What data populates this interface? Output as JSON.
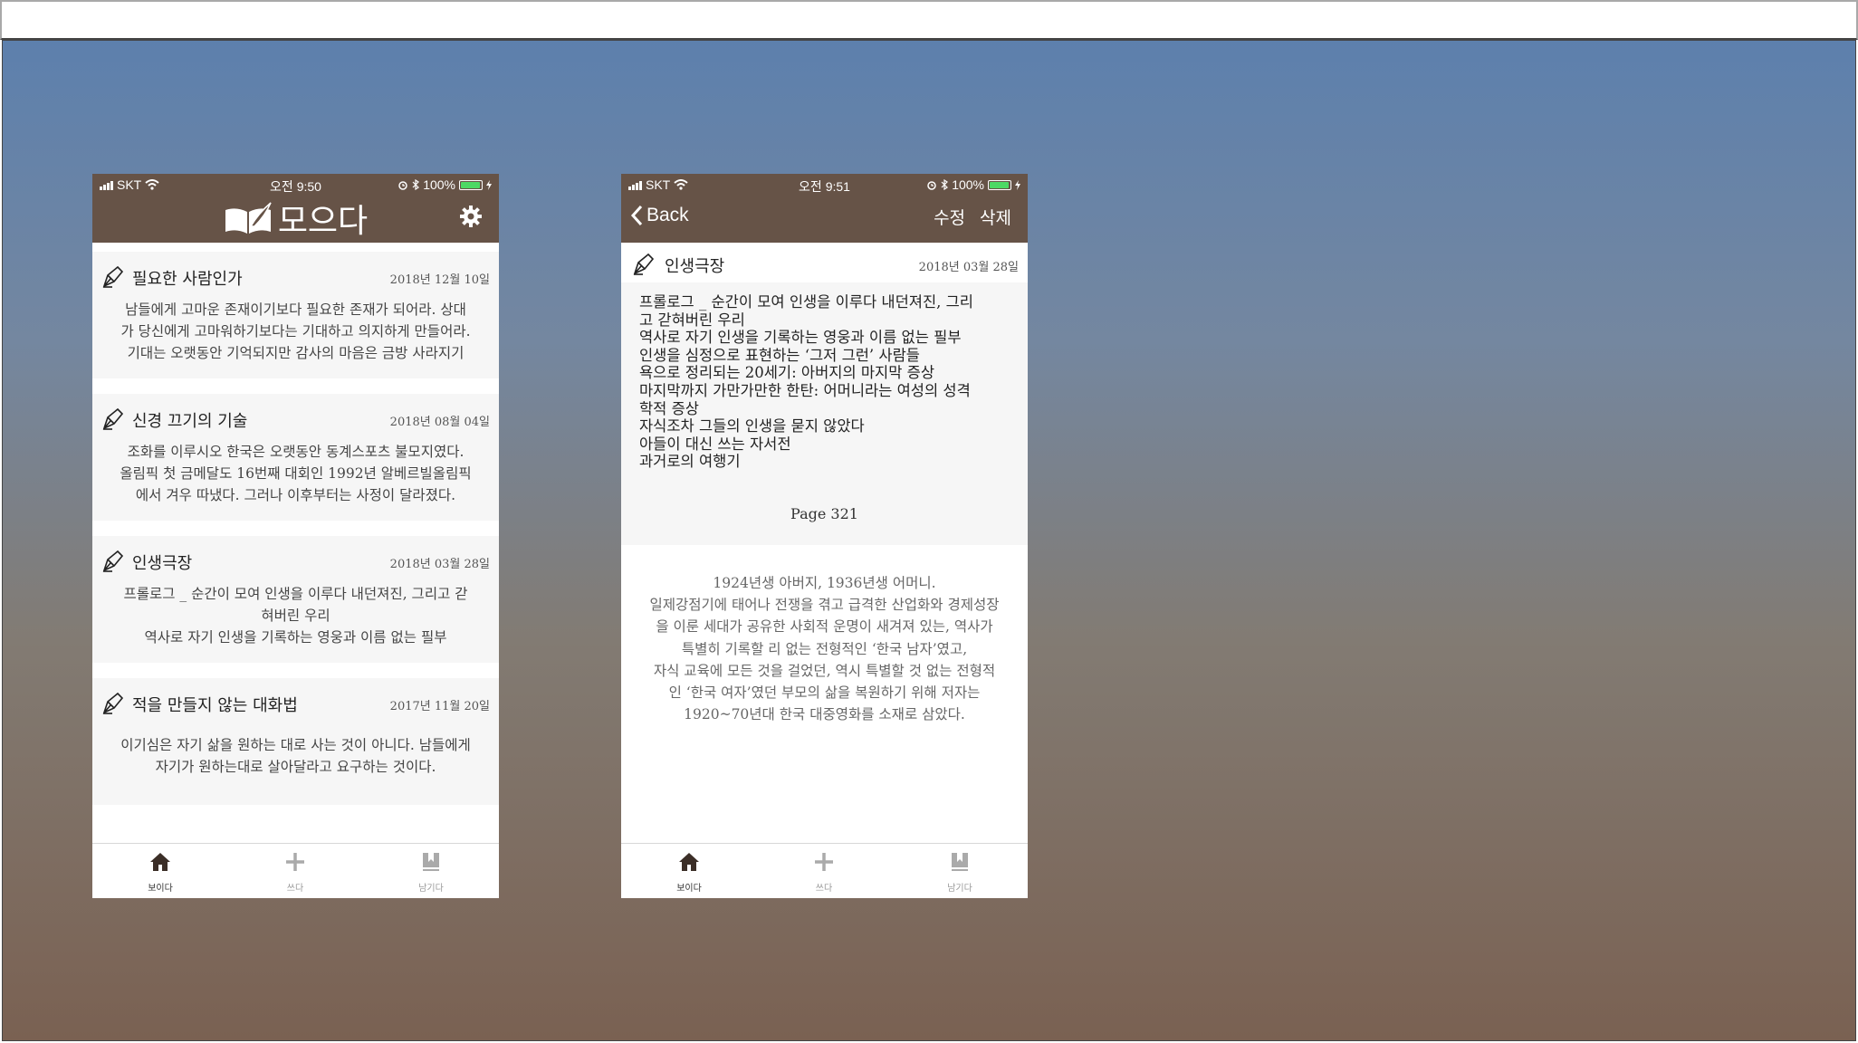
{
  "status_left": {
    "carrier": "SKT",
    "time": "오전 9:50",
    "battery": "100%"
  },
  "status_right": {
    "carrier": "SKT",
    "time": "오전 9:51",
    "battery": "100%"
  },
  "app": {
    "title": "모으다"
  },
  "list": [
    {
      "title": "필요한 사람인가",
      "date": "2018년 12월 10일",
      "lines": [
        "남들에게 고마운 존재이기보다 필요한 존재가 되어라. 상대",
        "가 당신에게 고마워하기보다는 기대하고 의지하게 만들어라.",
        "기대는 오랫동안 기억되지만 감사의 마음은 금방 사라지기"
      ]
    },
    {
      "title": "신경 끄기의 기술",
      "date": "2018년 08월 04일",
      "lines": [
        "조화를 이루시오 한국은 오랫동안 동계스포츠 불모지였다.",
        "올림픽 첫 금메달도 16번째 대회인 1992년 알베르빌올림픽",
        "에서 겨우 따냈다. 그러나 이후부터는 사정이 달라졌다."
      ]
    },
    {
      "title": "인생극장",
      "date": "2018년 03월 28일",
      "lines": [
        "프롤로그 _ 순간이 모여 인생을 이루다 내던져진, 그리고 갇",
        "혀버린 우리",
        "역사로 자기 인생을 기록하는 영웅과 이름 없는 필부"
      ]
    },
    {
      "title": "적을 만들지 않는 대화법",
      "date": "2017년 11월 20일",
      "lines": [
        "이기심은 자기 삶을 원하는 대로 사는 것이 아니다. 남들에게",
        "자기가 원하는대로 살아달라고 요구하는 것이다."
      ]
    }
  ],
  "detail": {
    "back_label": "Back",
    "edit_label": "수정",
    "delete_label": "삭제",
    "title": "인생극장",
    "date": "2018년 03월 28일",
    "toc": [
      "프롤로그 _ 순간이 모여 인생을 이루다 내던져진, 그리",
      "고 갇혀버린 우리",
      "역사로 자기 인생을 기록하는 영웅과 이름 없는 필부",
      "인생을 심정으로 표현하는 ‘그저 그런’ 사람들",
      "욕으로 정리되는 20세기: 아버지의 마지막 증상",
      "마지막까지 가만가만한 한탄: 어머니라는 여성의 성격",
      "학적 증상",
      "자식조차 그들의 인생을 묻지 않았다",
      "아들이 대신 쓰는 자서전",
      "과거로의 여행기"
    ],
    "page": "Page 321",
    "description": [
      "1924년생 아버지, 1936년생 어머니.",
      "일제강점기에 태어나 전쟁을 겪고 급격한 산업화와 경제성장",
      "을 이룬 세대가 공유한 사회적 운명이 새겨져 있는, 역사가",
      "특별히 기록할 리 없는 전형적인 ‘한국 남자’였고,",
      "자식 교육에 모든 것을 걸었던, 역시 특별할 것 없는 전형적",
      "인 ‘한국 여자’였던 부모의 삶을 복원하기 위해 저자는",
      "1920~70년대 한국 대중영화를 소재로 삼았다."
    ]
  },
  "tabs": [
    {
      "label": "보이다",
      "icon": "home-icon"
    },
    {
      "label": "쓰다",
      "icon": "plus-icon"
    },
    {
      "label": "남기다",
      "icon": "bookmark-icon"
    }
  ],
  "colors": {
    "header": "#665347",
    "card": "#f6f6f6",
    "battery": "#4cd964"
  }
}
